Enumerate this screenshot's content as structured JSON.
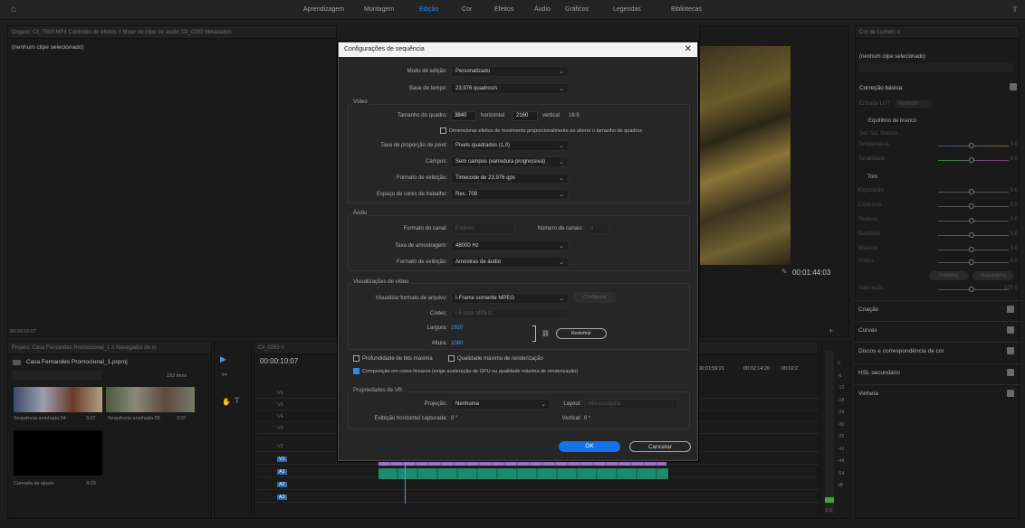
{
  "workspace_tabs": [
    "Aprendizagem",
    "Montagem",
    "Edição",
    "Cor",
    "Efeitos",
    "Áudio",
    "Gráficos",
    "Legendas",
    "Bibliotecas"
  ],
  "active_tab": "Edição",
  "left_panel": {
    "header": "Origem: Cli_7583.MP4   Controles de efeitos ≡   Mixer de clipe de áudio: Cli_0283   Metadados",
    "empty_text": "(nenhum clipe selecionado)",
    "timecode": "00:00:10:07"
  },
  "program_monitor": {
    "header": "Programa: Cli_0283 ≡",
    "timecode": "00:01:44:03"
  },
  "project": {
    "header": "Projeto: Casa Fernandes Promocional_1 ≡   Navegador de m",
    "name": "Casa Fernandes Promocional_1.prproj",
    "count": "193 itens",
    "items": [
      {
        "label": "Sequência aninhada 04",
        "dur": "3:07"
      },
      {
        "label": "Sequência aninhada 05",
        "dur": "3:07"
      },
      {
        "label": "Camada de ajuste",
        "dur": "4:23"
      }
    ]
  },
  "timeline": {
    "header": "Cli_0283 ≡",
    "timecode": "00:00:10:07",
    "ruler": [
      "00:01:59:21",
      "00:02:14:20",
      "00:02:2"
    ],
    "video_tracks": [
      "V6",
      "V5",
      "V4",
      "V3",
      "V2",
      "V1"
    ],
    "audio_tracks": [
      "A1",
      "A2",
      "A3"
    ],
    "meter_labels": [
      "0",
      "-6",
      "-12",
      "-18",
      "-24",
      "-30",
      "-36",
      "-42",
      "-48",
      "-54",
      "dB"
    ],
    "meter_bottom": "S S"
  },
  "lumetri": {
    "header": "Cor de Lumetri ≡",
    "no_clip": "(nenhum clipe selecionado)",
    "section_basic": "Correção básica",
    "input_lut": "Entrada LUT",
    "input_lut_value": "Nenhum",
    "white_balance": "Equilíbrio de branco",
    "wb_selector": "Sel. bal. branco",
    "temp": "Temperatura",
    "tint": "Tonalidade",
    "tone": "Tom",
    "exposure": "Exposição",
    "contrast": "Contraste",
    "highlights": "Realces",
    "shadows": "Sombras",
    "whites": "Brancos",
    "blacks": "Pretos",
    "reset": "Redefinir",
    "auto": "Automático",
    "saturation": "Saturação",
    "sat_val": "100.0",
    "val0": "0.0",
    "sections": [
      "Criação",
      "Curvas",
      "Discos e correspondência de cor",
      "HSL secundário",
      "Vinheta"
    ]
  },
  "dialog": {
    "title": "Configurações de sequência",
    "close": "✕",
    "edit_mode_label": "Modo de edição:",
    "edit_mode": "Personalizado",
    "timebase_label": "Base de tempo:",
    "timebase": "23,976 quadros/s",
    "video_title": "Vídeo",
    "frame_size_label": "Tamanho do quadro:",
    "frame_w": "3840",
    "horiz": "horizontal",
    "frame_h": "2160",
    "vert": "vertical",
    "aspect": "16:9",
    "scale_cb": "Dimensionar efeitos de movimento proporcionalmente ao alterar o tamanho de quadros",
    "pixel_aspect_label": "Taxa de proporção de pixel:",
    "pixel_aspect": "Pixels quadrados (1,0)",
    "fields_label": "Campos:",
    "fields": "Sem campos (varredura progressiva)",
    "display_format_label": "Formato de exibição:",
    "display_format": "Timecode de 23,976 qps",
    "color_space_label": "Espaço de cores de trabalho:",
    "color_space": "Rec. 709",
    "audio_title": "Áudio",
    "channel_format_label": "Formato do canal:",
    "channel_format": "Estéreo",
    "channels_label": "Número de canais:",
    "channels": "2",
    "sample_rate_label": "Taxa de amostragem:",
    "sample_rate": "48000 Hz",
    "audio_display_label": "Formato de exibição:",
    "audio_display": "Amostras de áudio",
    "previews_title": "Visualizações de vídeo",
    "preview_format_label": "Visualizar formato de arquivo:",
    "preview_format": "I-Frame somente MPEG",
    "configure": "Configurar",
    "codec_label": "Codec:",
    "codec": "I-Frame MPEG",
    "width_label": "Largura:",
    "width": "1920",
    "height_label": "Altura:",
    "height": "1080",
    "reset": "Redefinir",
    "max_bit_depth": "Profundidade de bits máxima",
    "max_render": "Qualidade máxima de renderização",
    "linear_comp": "Composição em cores lineares (exige aceleração de GPU ou qualidade máxima de renderização)",
    "vr_title": "Propriedades de VR",
    "projection_label": "Projeção:",
    "projection": "Nenhuma",
    "layout_label": "Layout:",
    "layout": "Monoscópico",
    "hcapture_label": "Exibição horizontal capturada:",
    "hcapture": "0 °",
    "vertical_label": "Vertical:",
    "vertical": "0 °",
    "ok": "OK",
    "cancel": "Cancelar"
  }
}
